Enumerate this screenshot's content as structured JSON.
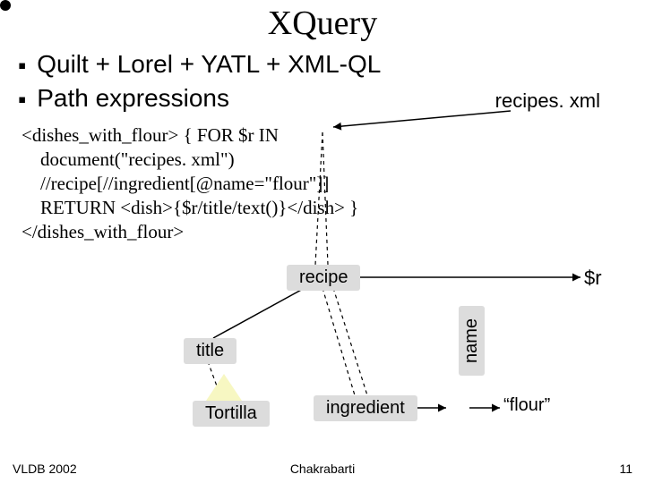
{
  "title": "XQuery",
  "bullets": [
    "Quilt + Lorel + YATL + XML-QL",
    "Path expressions"
  ],
  "label_recipes_xml": "recipes. xml",
  "code": "<dishes_with_flour> { FOR $r IN\n    document(\"recipes. xml\")\n    //recipe[//ingredient[@name=\"flour\"]]\n    RETURN <dish>{$r/title/text()}</dish> }\n</dishes_with_flour>",
  "nodes": {
    "recipe": "recipe",
    "title": "title",
    "tortilla": "Tortilla",
    "ingredient": "ingredient",
    "name": "name",
    "flour": "“flour”",
    "dollar_r": "$r"
  },
  "footer": {
    "left": "VLDB 2002",
    "center": "Chakrabarti",
    "right": "11"
  }
}
